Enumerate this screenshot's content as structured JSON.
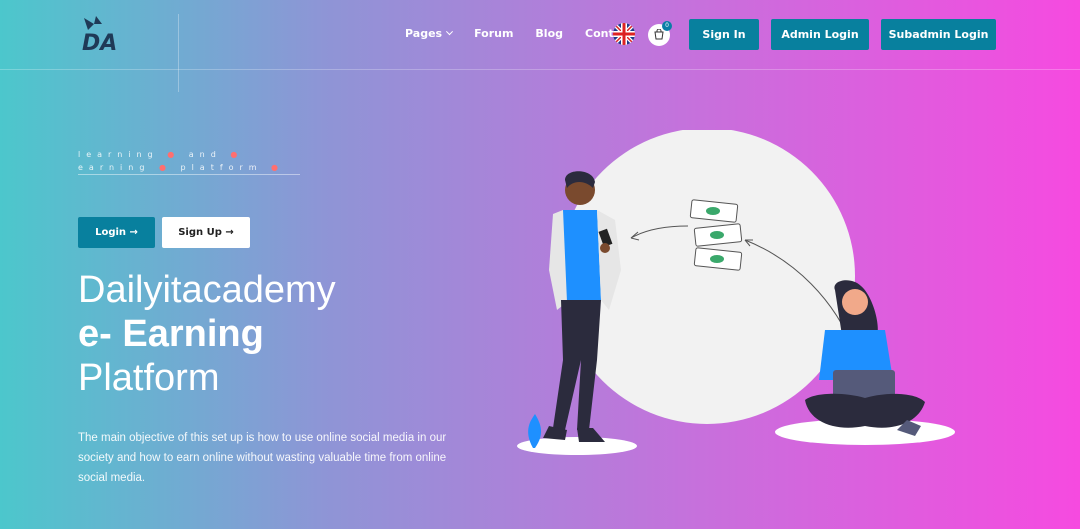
{
  "brand": {
    "logo_text": "DA"
  },
  "nav": {
    "items": [
      {
        "label": "Pages",
        "has_dropdown": true
      },
      {
        "label": "Forum"
      },
      {
        "label": "Blog"
      },
      {
        "label": "Contact"
      }
    ],
    "cart_count": "0",
    "buttons": {
      "sign_in": "Sign In",
      "admin_login": "Admin Login",
      "subadmin_login": "Subadmin Login"
    }
  },
  "hero": {
    "tagline_line1": "learning",
    "tagline_and": "and",
    "tagline_line2_a": "earning",
    "tagline_line2_b": "platform",
    "login_label": "Login →",
    "signup_label": "Sign Up →",
    "title_line1": "Dailyitacademy",
    "title_line2": "e- Earning",
    "title_line3": "Platform",
    "description": "The main objective of this set up is how to use online social media in our society and how to earn online without wasting valuable time from online social media."
  },
  "colors": {
    "accent": "#08809e",
    "gradient_start": "#4cc7cc",
    "gradient_end": "#f64ae0",
    "illustration_blue": "#1e90ff"
  }
}
